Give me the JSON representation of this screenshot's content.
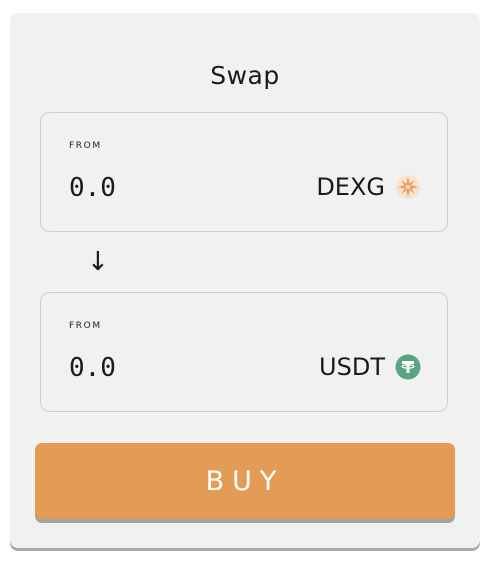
{
  "swap": {
    "title": "Swap",
    "from_panel": {
      "label": "FROM",
      "amount": "0.0",
      "token_symbol": "DEXG",
      "token_icon": "dexg-logo-icon"
    },
    "arrow_glyph": "↓",
    "to_panel": {
      "label": "FROM",
      "amount": "0.0",
      "token_symbol": "USDT",
      "token_icon": "usdt-tether-icon"
    },
    "buy_label": "BUY"
  },
  "colors": {
    "card_bg": "#f1f1f1",
    "accent": "#e49b56",
    "dexg_icon": "#e8a063",
    "usdt_icon": "#5aa383"
  }
}
